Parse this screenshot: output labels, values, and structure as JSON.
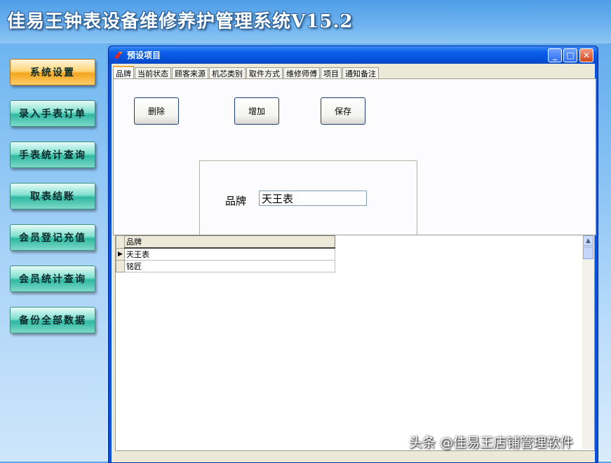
{
  "app": {
    "title": "佳易王钟表设备维修养护管理系统V15.2"
  },
  "sidebar": {
    "items": [
      {
        "label": "系统设置",
        "active": true
      },
      {
        "label": "录入手表订单"
      },
      {
        "label": "手表统计查询"
      },
      {
        "label": "取表结账"
      },
      {
        "label": "会员登记充值"
      },
      {
        "label": "会员统计查询"
      },
      {
        "label": "备份全部数据"
      }
    ]
  },
  "window": {
    "title": "预设项目",
    "controls": {
      "minimize": "_",
      "maximize": "□",
      "close": "✕"
    },
    "tabs": [
      {
        "label": "品牌",
        "active": true
      },
      {
        "label": "当前状态"
      },
      {
        "label": "顾客来源"
      },
      {
        "label": "机芯类别"
      },
      {
        "label": "取件方式"
      },
      {
        "label": "维修师傅"
      },
      {
        "label": "项目"
      },
      {
        "label": "通知备注"
      }
    ],
    "buttons": {
      "delete": "删除",
      "add": "增加",
      "save": "保存"
    },
    "form": {
      "label": "品牌",
      "value": "天王表"
    },
    "grid": {
      "column": "品牌",
      "rows": [
        "天王表",
        "铭匠"
      ],
      "current_row_marker": "▶"
    }
  },
  "watermark": "头条 @佳易王店铺管理软件",
  "colors": {
    "window_frame": "#0a52d8",
    "button_active": "#f2a51c",
    "button_normal": "#2fb8a2"
  },
  "icons": [
    "window-app-icon",
    "scroll-up-icon"
  ]
}
